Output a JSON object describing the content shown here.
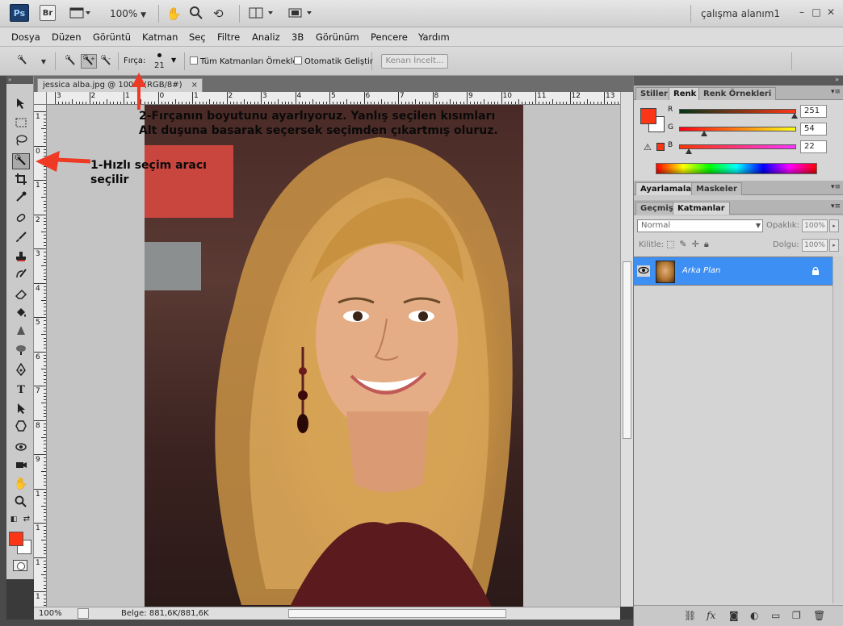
{
  "appbar": {
    "ps_logo": "Ps",
    "br_logo": "Br",
    "zoom": "100%",
    "workspace": "çalışma alanım1",
    "window_buttons": [
      "–",
      "□",
      "✕"
    ],
    "icons": [
      "screen-mode-icon",
      "hand-icon",
      "zoom-icon",
      "rotate-view-icon",
      "arrange-documents-icon",
      "screen-mode-menu-icon"
    ]
  },
  "menu": [
    "Dosya",
    "Düzen",
    "Görüntü",
    "Katman",
    "Seç",
    "Filtre",
    "Analiz",
    "3B",
    "Görünüm",
    "Pencere",
    "Yardım"
  ],
  "options": {
    "brush_label": "Fırça:",
    "brush_size": "21",
    "sample_all_label": "Tüm Katmanları Örnekle",
    "auto_enhance_label": "Otomatik Geliştir",
    "refine_edge_label": "Kenarı İncelt..."
  },
  "document": {
    "tab_title": "jessica alba.jpg @ 100% (RGB/8#)",
    "close": "×",
    "status_zoom": "100%",
    "status_info": "Belge: 881,6K/881,6K",
    "ruler_h": [
      "3",
      "2",
      "1",
      "0",
      "1",
      "2",
      "3",
      "4",
      "5",
      "6",
      "7",
      "8",
      "9",
      "10",
      "11",
      "12",
      "13"
    ],
    "ruler_v": [
      "1",
      "0",
      "1",
      "2",
      "3",
      "4",
      "5",
      "6",
      "7",
      "8",
      "9",
      "1",
      "1",
      "1",
      "1"
    ]
  },
  "annotations": {
    "step1_line1": "1-Hızlı seçim aracı",
    "step1_line2": "seçilir",
    "step2_line1": "2-Fırçanın boyutunu ayarlıyoruz. Yanlış seçilen kısımları",
    "step2_line2": "Alt duşuna basarak seçersek seçimden çıkartmış oluruz."
  },
  "color_panel": {
    "tabs": [
      "Stiller",
      "Renk",
      "Renk Örnekleri"
    ],
    "active_tab": "Renk",
    "foreground": "#fb3616",
    "background": "#ffffff",
    "channels": [
      {
        "label": "R",
        "value": "251",
        "fraction": 0.984
      },
      {
        "label": "G",
        "value": "54",
        "fraction": 0.212
      },
      {
        "label": "B",
        "value": "22",
        "fraction": 0.086
      }
    ]
  },
  "adjust_tabs": [
    "Ayarlamalar",
    "Maskeler"
  ],
  "layers_panel": {
    "tabs": [
      "Geçmiş",
      "Katmanlar"
    ],
    "active_tab": "Katmanlar",
    "blend_mode": "Normal",
    "opacity_label": "Opaklık:",
    "opacity_value": "100%",
    "lock_label": "Kilitle:",
    "fill_label": "Dolgu:",
    "fill_value": "100%",
    "layers": [
      {
        "name": "Arka Plan",
        "locked": true,
        "visible": true
      }
    ]
  }
}
